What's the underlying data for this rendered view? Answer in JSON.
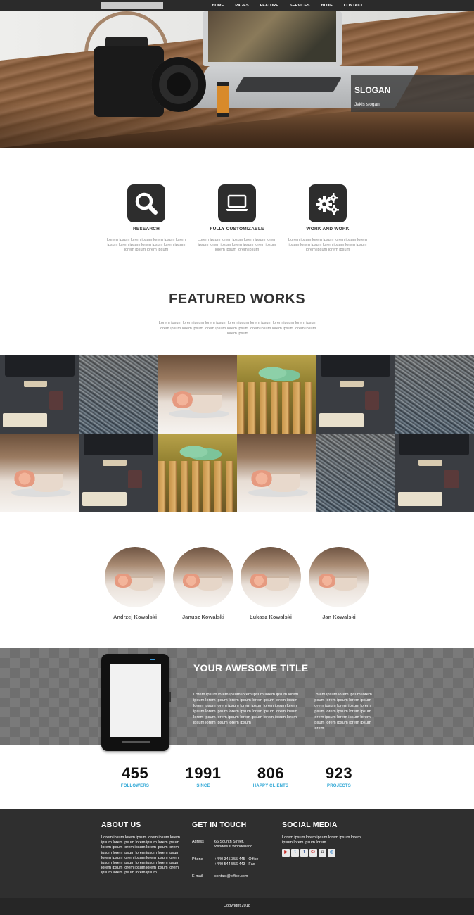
{
  "nav": {
    "logo_text": "",
    "items": [
      "HOME",
      "PAGES",
      "FEATURE",
      "SERVICES",
      "BLOG",
      "CONTACT"
    ]
  },
  "hero": {
    "slogan_title": "SLOGAN",
    "slogan_text": "Jakiś slogan"
  },
  "features": [
    {
      "icon": "search-icon",
      "title": "RESEARCH",
      "text": "Lorem ipsum lorem ipsum lorem ipsum lorem ipsum lorem ipsum lorem ipsum lorem ipsum lorem ipsum lorem ipsum"
    },
    {
      "icon": "laptop-icon",
      "title": "FULLY CUSTOMIZABLE",
      "text": "Lorem ipsum lorem ipsum lorem ipsum lorem ipsum lorem ipsum lorem ipsum lorem ipsum lorem ipsum lorem ipsum"
    },
    {
      "icon": "gears-icon",
      "title": "WORK AND WORK",
      "text": "Lorem ipsum lorem ipsum lorem ipsum lorem ipsum lorem ipsum lorem ipsum lorem ipsum lorem ipsum lorem ipsum"
    }
  ],
  "featured": {
    "title": "FEATURED WORKS",
    "description": "Lorem ipsum lorem ipsum lorem ipsum lorem ipsum lorem ipsum lorem ipsum lorem ipsum lorem ipsum lorem ipsum lorem ipsum lorem ipsum lorem ipsum lorem ipsum lorem ipsum lorem ipsum",
    "grid": [
      "desk",
      "grass",
      "cup",
      "fence",
      "desk",
      "grass",
      "cup",
      "desk",
      "fence",
      "cup",
      "grass",
      "desk"
    ]
  },
  "team": [
    {
      "name": "Andrzej Kowalski"
    },
    {
      "name": "Janusz Kowalski"
    },
    {
      "name": "Łukasz Kowalski"
    },
    {
      "name": "Jan Kowalski"
    }
  ],
  "banner": {
    "title": "YOUR AWESOME TITLE",
    "col1": "Lorem ipsum lorem ipsum lorem ipsum lorem ipsum lorem ipsum lorem ipsum lorem ipsum lorem ipsum lorem ipsum lorem ipsum lorem ipsum lorem ipsum lorem ipsum lorem ipsum lorem ipsum lorem ipsum lorem ipsum lorem ipsum lorem ipsum lorem ipsum lorem ipsum lorem ipsum lorem ipsum lorem ipsum lorem ipsum",
    "col2": "Lorem ipsum lorem ipsum lorem ipsum lorem ipsum lorem ipsum lorem ipsum lorem ipsum lorem ipsum lorem ipsum lorem ipsum lorem ipsum lorem ipsum lorem ipsum lorem ipsum lorem ipsum lorem"
  },
  "stats": [
    {
      "value": "455",
      "label": "FOLLOWERS"
    },
    {
      "value": "1991",
      "label": "SINCE"
    },
    {
      "value": "806",
      "label": "HAPPY CLIENTS"
    },
    {
      "value": "923",
      "label": "PROJECTS"
    }
  ],
  "footer": {
    "about_title": "ABOUT US",
    "about_text": "Lorem ipsum lorem ipsum lorem ipsum lorem ipsum lorem ipsum lorem ipsum lorem ipsum lorem ipsum lorem ipsum lorem ipsum lorem ipsum lorem ipsum lorem ipsum lorem ipsum lorem ipsum lorem ipsum lorem ipsum lorem ipsum lorem ipsum lorem ipsum lorem ipsum lorem ipsum lorem ipsum lorem ipsum lorem ipsum lorem ipsum lorem ipsum",
    "contact_title": "GET IN TOUCH",
    "address_label": "Adress",
    "address_line1": "66 Sounth Street,",
    "address_line2": "Window 6 Wonderland",
    "phone_label": "Phone",
    "phone_line1": "+440 345 355 445 - Office",
    "phone_line2": "+440 544 556 443 - Fax",
    "email_label": "E-mail",
    "email_value": "contact@office.com",
    "social_title": "SOCIAL MEDIA",
    "social_text": "Lorem ipsum lorem ipsum lorem ipsum lorem ipsum lorem ipsum lorem",
    "social_icons": [
      "youtube-icon",
      "twitter-icon",
      "facebook-icon",
      "google-plus-icon",
      "instagram-icon",
      "dribbble-icon"
    ],
    "copyright": "Copyright 2018"
  },
  "colors": {
    "nav_bg": "#2b2b2b",
    "accent_blue": "#2fa7d6",
    "footer_bg": "#2f2f2f",
    "icon_tile": "#2d2d2d",
    "social_red": "#c9302c",
    "social_blue": "#3b8bd0"
  }
}
